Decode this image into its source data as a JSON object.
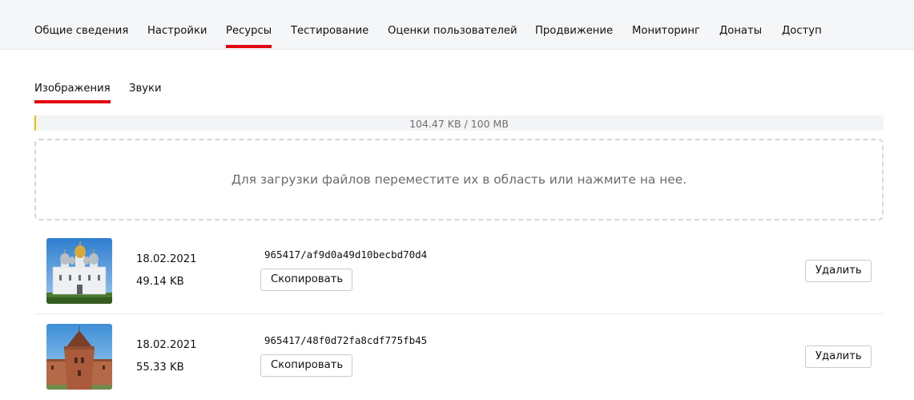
{
  "top_nav": {
    "tabs": [
      {
        "label": "Общие сведения"
      },
      {
        "label": "Настройки"
      },
      {
        "label": "Ресурсы"
      },
      {
        "label": "Тестирование"
      },
      {
        "label": "Оценки пользователей"
      },
      {
        "label": "Продвижение"
      },
      {
        "label": "Мониторинг"
      },
      {
        "label": "Донаты"
      },
      {
        "label": "Доступ"
      }
    ],
    "active": "Ресурсы"
  },
  "resource_tabs": {
    "tabs": [
      {
        "label": "Изображения"
      },
      {
        "label": "Звуки"
      }
    ],
    "active": "Изображения"
  },
  "quota": {
    "text": "104.47 KB / 100 MB",
    "used_fraction": 0.001
  },
  "dropzone": {
    "text": "Для загрузки файлов переместите их в область или нажмите на нее."
  },
  "files": [
    {
      "date": "18.02.2021",
      "size": "49.14 KB",
      "id": "965417/af9d0a49d10becbd70d4",
      "copy_label": "Скопировать",
      "delete_label": "Удалить",
      "thumbnail": "cathedral-photo"
    },
    {
      "date": "18.02.2021",
      "size": "55.33 KB",
      "id": "965417/48f0d72fa8cdf775fb45",
      "copy_label": "Скопировать",
      "delete_label": "Удалить",
      "thumbnail": "tower-photo"
    }
  ],
  "colors": {
    "accent": "#e30611",
    "nav_background": "#f5f6f7",
    "quota_fill": "#e8c400"
  }
}
